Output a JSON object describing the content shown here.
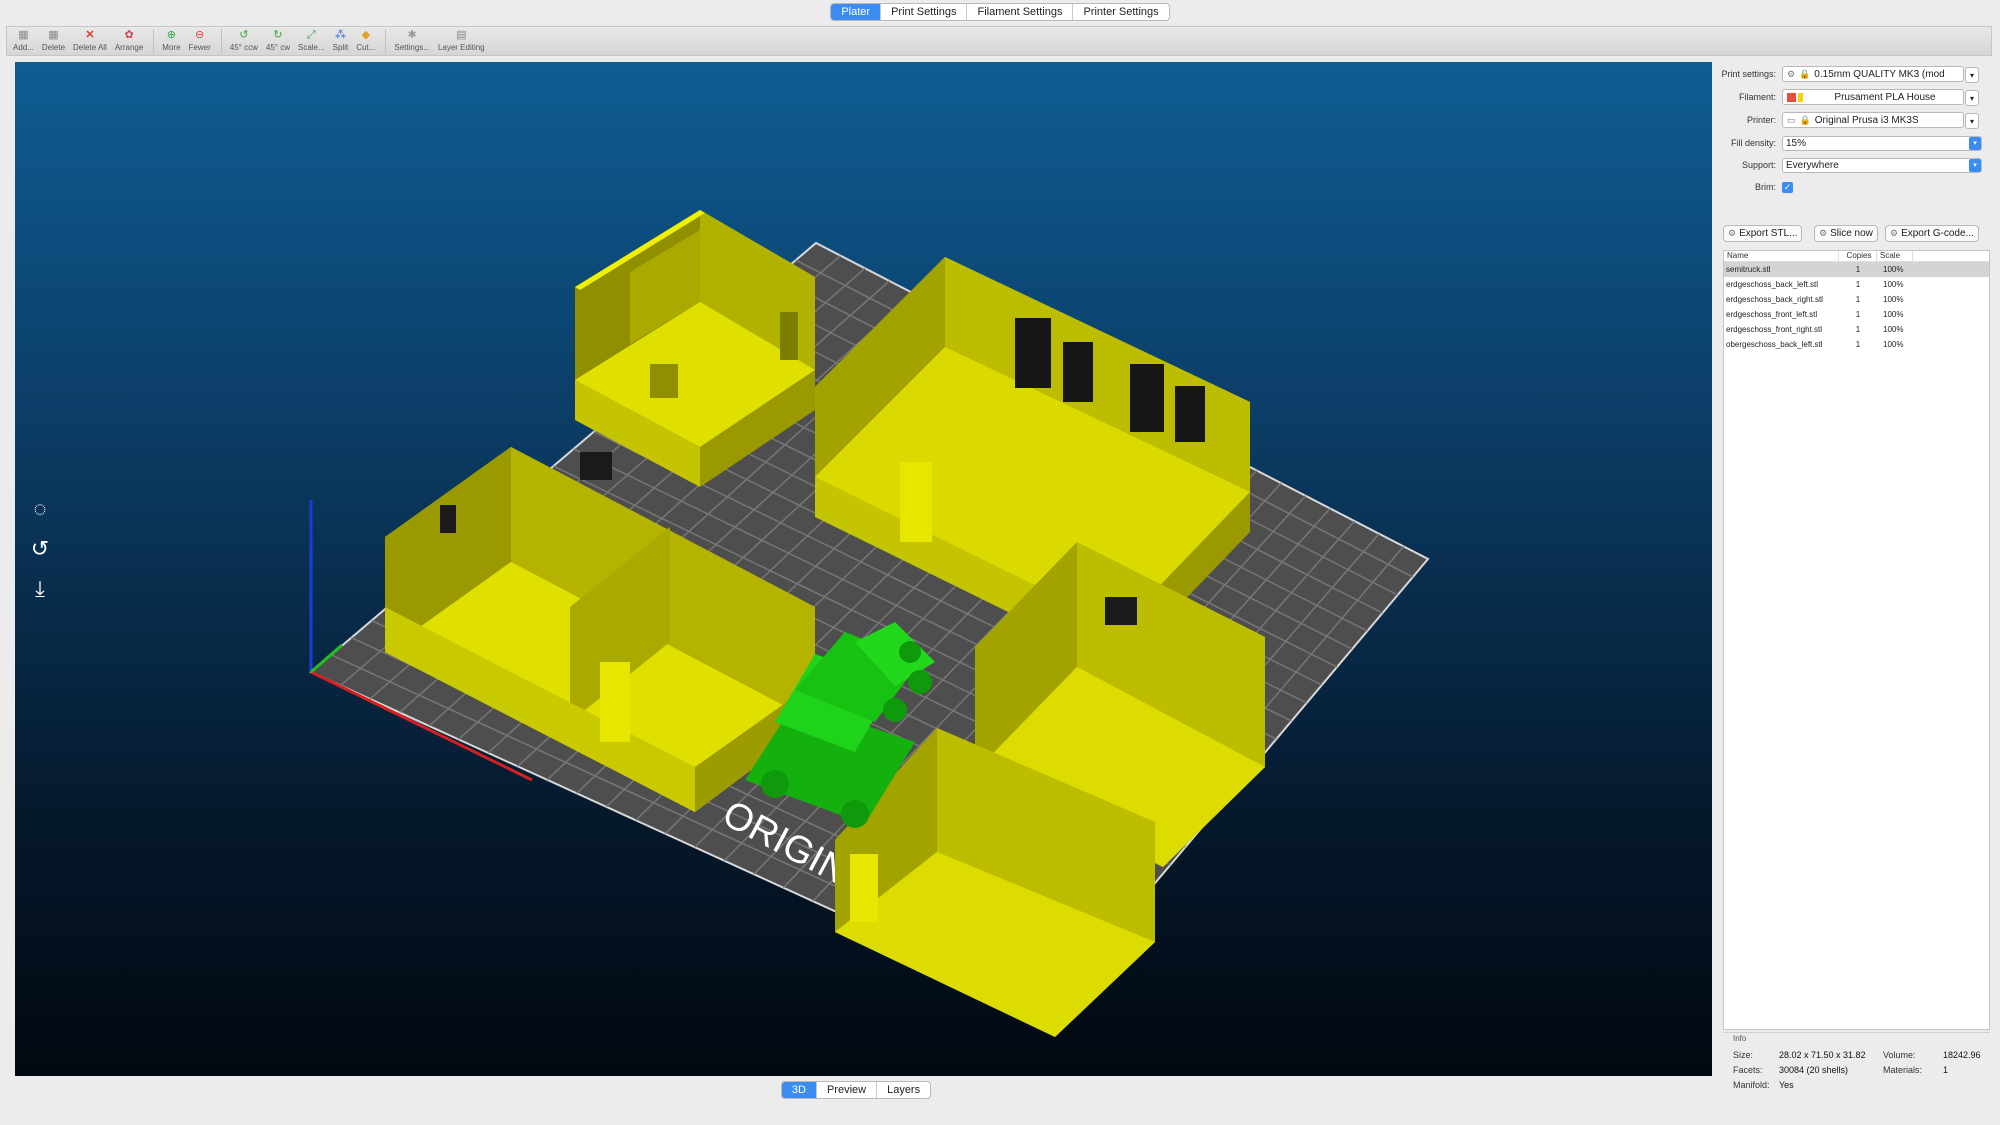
{
  "top_tabs": [
    "Plater",
    "Print Settings",
    "Filament Settings",
    "Printer Settings"
  ],
  "toolbar": [
    {
      "label": "Add...",
      "icon": "add-icon"
    },
    {
      "label": "Delete",
      "icon": "delete-icon"
    },
    {
      "label": "Delete All",
      "icon": "delete-all-icon"
    },
    {
      "label": "Arrange",
      "icon": "arrange-icon"
    },
    {
      "label": "More",
      "icon": "more-icon"
    },
    {
      "label": "Fewer",
      "icon": "fewer-icon"
    },
    {
      "label": "45° ccw",
      "icon": "rotate-ccw-icon"
    },
    {
      "label": "45° cw",
      "icon": "rotate-cw-icon"
    },
    {
      "label": "Scale...",
      "icon": "scale-icon"
    },
    {
      "label": "Split",
      "icon": "split-icon"
    },
    {
      "label": "Cut...",
      "icon": "cut-icon"
    },
    {
      "label": "Settings...",
      "icon": "settings-icon"
    },
    {
      "label": "Layer Editing",
      "icon": "layer-editing-icon"
    }
  ],
  "view_tabs": [
    "3D",
    "Preview",
    "Layers"
  ],
  "bed_label": "ORIGINA",
  "panel": {
    "print_settings_label": "Print settings:",
    "print_settings_value": "0.15mm QUALITY MK3 (mod",
    "filament_label": "Filament:",
    "filament_value": "Prusament PLA House",
    "printer_label": "Printer:",
    "printer_value": "Original Prusa i3 MK3S",
    "fill_density_label": "Fill density:",
    "fill_density_value": "15%",
    "support_label": "Support:",
    "support_value": "Everywhere",
    "brim_label": "Brim:",
    "brim_checked": true,
    "export_stl": "Export STL...",
    "slice_now": "Slice now",
    "export_gcode": "Export G-code..."
  },
  "object_list": {
    "headers": [
      "Name",
      "Copies",
      "Scale"
    ],
    "rows": [
      {
        "name": "semitruck.stl",
        "copies": "1",
        "scale": "100%"
      },
      {
        "name": "erdgeschoss_back_left.stl",
        "copies": "1",
        "scale": "100%"
      },
      {
        "name": "erdgeschoss_back_right.stl",
        "copies": "1",
        "scale": "100%"
      },
      {
        "name": "erdgeschoss_front_left.stl",
        "copies": "1",
        "scale": "100%"
      },
      {
        "name": "erdgeschoss_front_right.stl",
        "copies": "1",
        "scale": "100%"
      },
      {
        "name": "obergeschoss_back_left.stl",
        "copies": "1",
        "scale": "100%"
      }
    ]
  },
  "info": {
    "title": "Info",
    "size_label": "Size:",
    "size_value": "28.02 x 71.50 x 31.82",
    "volume_label": "Volume:",
    "volume_value": "18242.96",
    "facets_label": "Facets:",
    "facets_value": "30084 (20 shells)",
    "materials_label": "Materials:",
    "materials_value": "1",
    "manifold_label": "Manifold:",
    "manifold_value": "Yes"
  },
  "colors": {
    "accent": "#3b8cf0",
    "model_yellow": "#c8c800",
    "selected_green": "#16c40e",
    "bed": "#505050"
  }
}
